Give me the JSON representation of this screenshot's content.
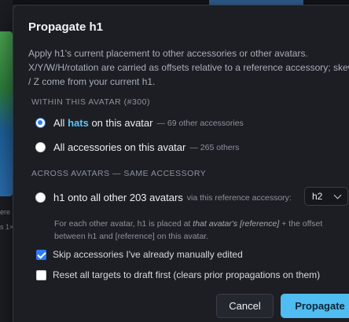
{
  "background": {
    "snippet_1": "ere",
    "snippet_2": "s 1×"
  },
  "dialog": {
    "title": "Propagate h1",
    "description_lines": [
      "Apply h1's current placement to other accessories or other avatars.",
      "X/Y/W/H/rotation are carried as offsets relative to a reference accessory; skew",
      "/ Z come from your current h1."
    ],
    "section_within": "WITHIN THIS AVATAR (#300)",
    "option_all_hats": {
      "prefix": "All",
      "highlight": "hats",
      "suffix": "on this avatar",
      "sub": "— 69 other accessories",
      "selected": true
    },
    "option_all_accessories": {
      "label": "All accessories on this avatar",
      "sub": "— 265 others",
      "selected": false
    },
    "section_across": "ACROSS AVATARS — SAME ACCESSORY",
    "option_across": {
      "label": "h1 onto all other 203 avatars",
      "sub": "via this reference accessory:",
      "selected": false
    },
    "reference_select": {
      "value": "h2"
    },
    "note": {
      "line1_a": "For each other avatar, h1 is placed at",
      "line1_em": "that avatar's [reference]",
      "line1_b": "+ the offset",
      "line2": "between h1 and [reference] on this avatar."
    },
    "skip_edited": {
      "label": "Skip accessories I've already manually edited",
      "checked": true
    },
    "reset_draft": {
      "label": "Reset all targets to draft first (clears prior propagations on them)",
      "checked": false
    },
    "cancel_label": "Cancel",
    "propagate_label": "Propagate",
    "colors": {
      "accent": "#2f7cf6",
      "highlight": "#5cc4f5",
      "primary_button": "#4fbdf2",
      "dialog_bg": "#1c1e24"
    }
  }
}
